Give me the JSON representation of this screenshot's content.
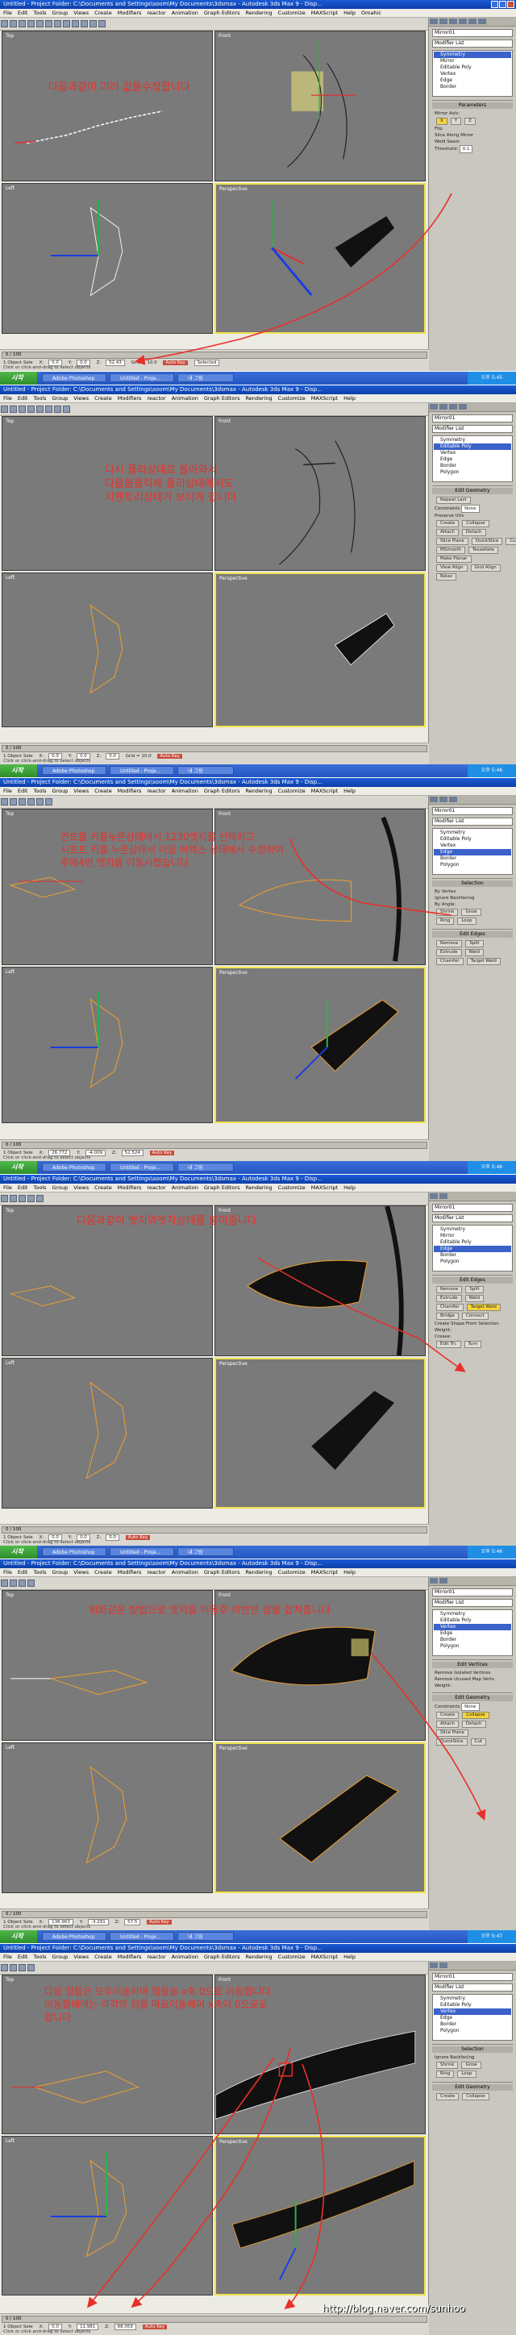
{
  "window": {
    "title": "Untitled - Project Folder: C:\\Documents and Settings\\soom\\My Documents\\3dsmax - Autodesk 3ds Max 9 - Disp...",
    "menu": [
      "File",
      "Edit",
      "Tools",
      "Group",
      "Views",
      "Create",
      "Modifiers",
      "reactor",
      "Animation",
      "Graph Editors",
      "Rendering",
      "Customize",
      "MAXScript",
      "Help",
      "Omahic"
    ]
  },
  "taskbar": {
    "start_label": "시작",
    "tasks": [
      "Adobe Photoshop",
      "Untitled - Proje...",
      "내 그림"
    ],
    "clock": [
      "오후 5:45",
      "오후 5:46",
      "오후 5:46",
      "오후 5:46",
      "오후 5:47"
    ]
  },
  "viewports": [
    "Top",
    "Front",
    "Left",
    "Perspective"
  ],
  "command_panel": {
    "object_name": "Mirror01",
    "modifier_list": "Modifier List",
    "stack": [
      "Symmetry",
      "Mirror",
      "Editable Poly",
      "Vertex",
      "Edge",
      "Border",
      "Polygon",
      "Element"
    ],
    "mirror_axis_title": "Parameters",
    "mirror_axis_label": "Mirror Axis:",
    "axes": [
      "X",
      "Y",
      "Z"
    ],
    "flip": "Flip",
    "slice": "Slice Along Mirror",
    "weld": "Weld Seam",
    "threshold_label": "Threshold:",
    "threshold_value": "0.1",
    "selection_title": "Selection",
    "by_vertex": "By Vertex",
    "ignore_backfacing": "Ignore Backfacing",
    "by_angle": "By Angle:",
    "shrink": "Shrink",
    "grow": "Grow",
    "ring": "Ring",
    "loop": "Loop",
    "edit_edges_title": "Edit Edges",
    "remove": "Remove",
    "split": "Split",
    "extrude": "Extrude",
    "weld_btn": "Weld",
    "chamfer": "Chamfer",
    "target_weld": "Target Weld",
    "bridge": "Bridge",
    "connect": "Connect",
    "create_shape": "Create Shape From Selection",
    "weight": "Weight:",
    "crease": "Crease:",
    "edit_tri": "Edit Tri.",
    "turn": "Turn",
    "edit_geometry_title": "Edit Geometry",
    "repeat_last": "Repeat Last",
    "constraints": "Constraints",
    "none": "None",
    "preserve_uvs": "Preserve UVs",
    "create": "Create",
    "collapse": "Collapse",
    "attach": "Attach",
    "detach": "Detach",
    "slice_plane": "Slice Plane",
    "quickslice": "QuickSlice",
    "cut": "Cut",
    "msmooth": "MSmooth",
    "tessellate": "Tessellate",
    "make_planar": "Make Planar",
    "view_align": "View Align",
    "grid_align": "Grid Align",
    "relax": "Relax",
    "remove_isolated": "Remove Isolated Vertices",
    "remove_unused": "Remove Unused Map Verts",
    "edit_vertices_title": "Edit Vertices"
  },
  "statusbar": {
    "frame": "0 / 100",
    "selected": "1 Object Sele",
    "prompt": "Click or click-and-drag to select objects",
    "x_label": "X:",
    "y_label": "Y:",
    "z_label": "Z:",
    "x_values": [
      "0.0",
      "0.0",
      "26.772",
      "0.0",
      "136.963",
      "0.0"
    ],
    "y_values": [
      "0.0",
      "0.0",
      "-4.009",
      "0.0",
      "-3.291",
      "11.981"
    ],
    "z_values": [
      "52.43",
      "0.0",
      "52.524",
      "0.0",
      "57.5",
      "68.059"
    ],
    "grid": "Grid = 10.0",
    "auto_key": "Auto Key",
    "selected_label": "Selected",
    "set_key": "Set Key",
    "key_filters": "Key Filters...",
    "add_time_tag": "Add Time Tag"
  },
  "annotations": [
    [
      "다음과같이 미러 값을수정합니다"
    ],
    [
      "다시 폴리상태로 돌아와서",
      "다음을클릭해 폴리상태에서도",
      "시멘트리상태가 보이게 합니다"
    ],
    [
      "컨트롤 키를누른상태에서 1230엣지를 선택하고",
      "시프트 키를 누른상태서 이동 버텍스 상태에서 수정하여",
      "후에4번 엣지를 이동시켰습니다"
    ],
    [
      "다음과같이 엣지와엣지상태를 붙여줍니다"
    ],
    [
      "위와같은 방법으로 엣지를 이동후 이번엔 점을 합쳐줍니다"
    ],
    [
      "다음 점들은 모두이동하여 점들을 x축 0으로 이동합니다",
      "이동할때에는 각각의 점을 마로이동해어 x축이 0으로로",
      "합니다"
    ]
  ],
  "watermark": "http://blog.naver.com/sunhoo"
}
